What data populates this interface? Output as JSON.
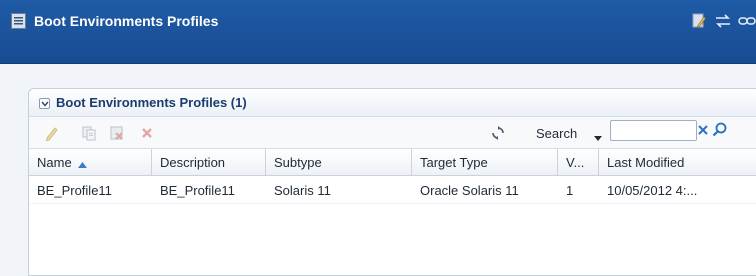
{
  "header": {
    "title": "Boot Environments Profiles",
    "icons": [
      "list-page-icon",
      "edit-document-icon",
      "swap-icon",
      "link-icon"
    ]
  },
  "panel": {
    "title": "Boot Environments Profiles (1)"
  },
  "toolbar": {
    "search_label": "Search",
    "search_value": "",
    "icons": [
      "edit-icon",
      "duplicate-icon",
      "delete-version-icon",
      "delete-icon",
      "refresh-icon",
      "clear-icon",
      "search-icon"
    ]
  },
  "table": {
    "columns": [
      "Name",
      "Description",
      "Subtype",
      "Target Type",
      "V...",
      "Last Modified"
    ],
    "sorted_column": "Name",
    "sort_direction": "ascending",
    "rows": [
      [
        "BE_Profile11",
        "BE_Profile11",
        "Solaris 11",
        "Oracle Solaris 11",
        "1",
        "10/05/2012 4:..."
      ]
    ]
  },
  "colors": {
    "header_bg": "#1f5aa6",
    "panel_title": "#1a3c6e",
    "accent_icon": "#2c6fbf"
  }
}
